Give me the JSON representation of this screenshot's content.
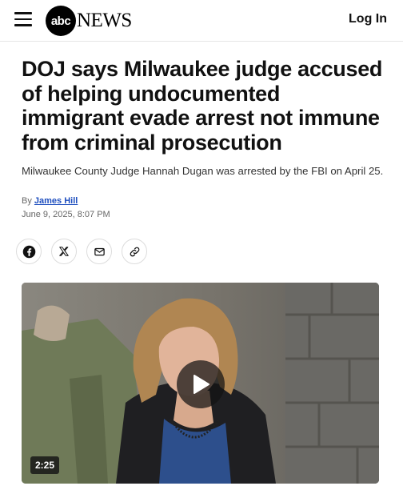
{
  "header": {
    "menu_icon": "hamburger-icon",
    "logo_mark": "abc",
    "logo_word": "NEWS",
    "login_label": "Log In"
  },
  "article": {
    "headline": "DOJ says Milwaukee judge accused of helping undocumented immigrant evade arrest not immune from criminal prosecution",
    "subheadline": "Milwaukee County Judge Hannah Dugan was arrested by the FBI on April 25.",
    "byline_prefix": "By",
    "author": "James Hill",
    "date": "June 9, 2025, 8:07 PM"
  },
  "share": [
    {
      "icon": "facebook-icon"
    },
    {
      "icon": "x-icon"
    },
    {
      "icon": "email-icon"
    },
    {
      "icon": "link-icon"
    }
  ],
  "video": {
    "duration": "2:25",
    "play_icon": "play-icon"
  }
}
